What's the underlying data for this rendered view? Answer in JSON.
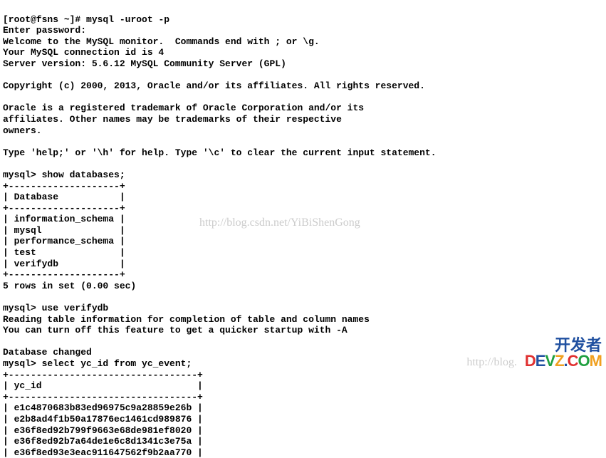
{
  "prompt_shell": "[root@fsns ~]# ",
  "cmd_mysql_login": "mysql -uroot -p",
  "enter_password": "Enter password:",
  "welcome_line": "Welcome to the MySQL monitor.  Commands end with ; or \\g.",
  "connection_line": "Your MySQL connection id is 4",
  "server_version_line": "Server version: 5.6.12 MySQL Community Server (GPL)",
  "copyright_line": "Copyright (c) 2000, 2013, Oracle and/or its affiliates. All rights reserved.",
  "trademark_line_1": "Oracle is a registered trademark of Oracle Corporation and/or its",
  "trademark_line_2": "affiliates. Other names may be trademarks of their respective",
  "trademark_line_3": "owners.",
  "help_line": "Type 'help;' or '\\h' for help. Type '\\c' to clear the current input statement.",
  "mysql_prompt": "mysql> ",
  "cmd_show_databases": "show databases;",
  "db_table_border": "+--------------------+",
  "db_table_header": "| Database           |",
  "databases": [
    "| information_schema |",
    "| mysql              |",
    "| performance_schema |",
    "| test               |",
    "| verifydb           |"
  ],
  "db_row_summary": "5 rows in set (0.00 sec)",
  "cmd_use_db": "use verifydb",
  "reading_table_info": "Reading table information for completion of table and column names",
  "turn_off_feature": "You can turn off this feature to get a quicker startup with -A",
  "database_changed": "Database changed",
  "cmd_select": "select yc_id from yc_event;",
  "yc_table_border": "+----------------------------------+",
  "yc_table_header": "| yc_id                            |",
  "yc_rows": [
    "| e1c4870683b83ed96975c9a28859e26b |",
    "| e2b8ad4f1b50a17876ec1461cd989876 |",
    "| e36f8ed92b799f9663e68de981ef8020 |",
    "| e36f8ed92b7a64de1e6c8d1341c3e75a |",
    "| e36f8ed93e3eac911647562f9b2aa770 |"
  ],
  "watermark_center": "http://blog.csdn.net/YiBiShenGong",
  "watermark_bottom": "http://blog.",
  "logo_text_top": "开发者",
  "logo_d": "D",
  "logo_e": "E",
  "logo_v": "V",
  "logo_z": "Z",
  "logo_dot": ".",
  "logo_c": "C",
  "logo_o": "O",
  "logo_m": "M"
}
